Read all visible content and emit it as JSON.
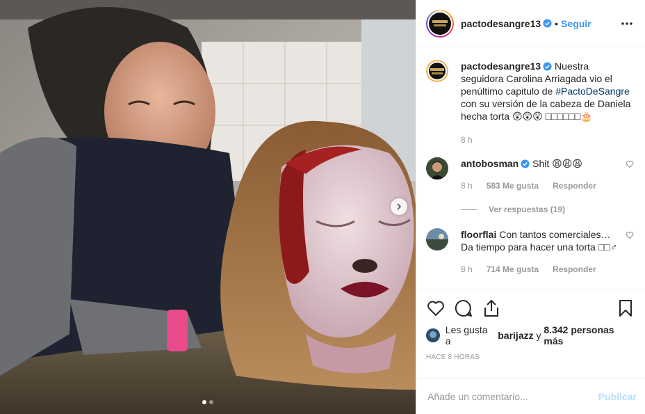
{
  "post": {
    "author": "pactodesangre13",
    "follow_label": "Seguir",
    "separator": "•",
    "carousel": {
      "slides": 2,
      "active_index": 1
    }
  },
  "caption": {
    "username": "pactodesangre13",
    "text_before": " Nuestra seguidora Carolina Arriagada vio el penúltimo capitulo de ",
    "hashtag": "#PactoDeSangre",
    "text_after": " con su versión de la cabeza de Daniela hecha torta 😲😲😲 □□□□□□🎂",
    "time": "8 h"
  },
  "comments": [
    {
      "username": "antobosman",
      "text": " Shit 😩😩😩",
      "time": "8 h",
      "likes": "583 Me gusta",
      "reply_label": "Responder",
      "view_replies": "Ver respuestas (19)"
    },
    {
      "username": "floorflai",
      "text": " Con tantos comerciales… Da tiempo para hacer una torta □□♂",
      "time": "8 h",
      "likes": "714 Me gusta",
      "reply_label": "Responder"
    }
  ],
  "likes_line": {
    "prefix": "Les gusta a ",
    "user": "barijazz",
    "middle": " y ",
    "count": "8.342 personas más"
  },
  "posted_ago": "HACE 8 HORAS",
  "comment_box": {
    "placeholder": "Añade un comentario...",
    "publish_label": "Publicar"
  },
  "colors": {
    "link": "#3897f0",
    "hashtag": "#003569",
    "muted": "#999999",
    "verified": "#3897f0",
    "publish_disabled": "#b2dffc"
  },
  "icons": [
    "more-options-icon",
    "verified-badge-icon",
    "heart-icon",
    "comment-icon",
    "share-icon",
    "bookmark-icon",
    "next-arrow-icon",
    "small-heart-icon"
  ]
}
